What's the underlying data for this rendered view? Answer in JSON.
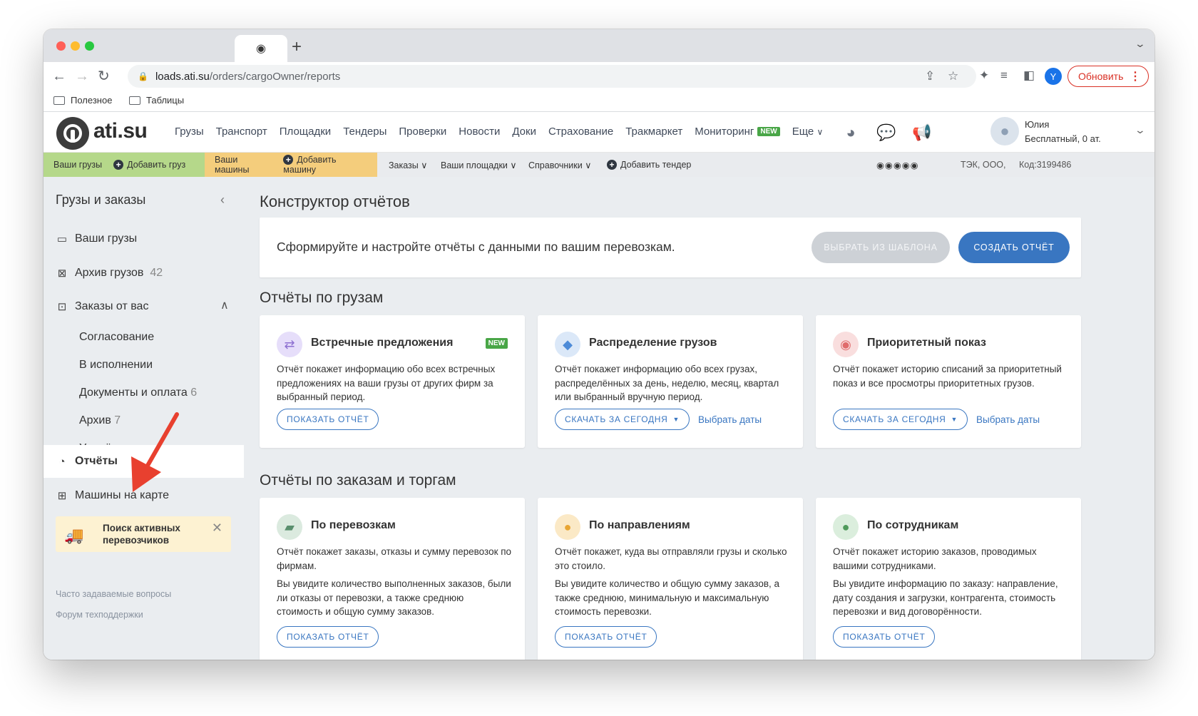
{
  "browser": {
    "url_host": "loads.ati.su",
    "url_path": "/orders/cargoOwner/reports",
    "update_label": "Обновить",
    "avatar_letter": "Y",
    "tab_icon": "ati-logo-icon",
    "new_tab": "+",
    "bookmarks": [
      "Полезное",
      "Таблицы"
    ]
  },
  "header": {
    "logo_text": "ati.su",
    "nav": [
      "Грузы",
      "Транспорт",
      "Площадки",
      "Тендеры",
      "Проверки",
      "Новости",
      "Доки",
      "Страхование",
      "Тракмаркет",
      "Мониторинг"
    ],
    "new_badge": "NEW",
    "more": "Еще",
    "user_name": "Юлия",
    "user_plan": "Бесплатный,  0 ат."
  },
  "subnav": {
    "your_cargo": "Ваши грузы",
    "add_cargo": "Добавить груз",
    "your_machines": "Ваши машины",
    "add_machine": "Добавить машину",
    "orders": "Заказы",
    "platforms": "Ваши площадки",
    "references": "Справочники",
    "add_tender": "Добавить тендер",
    "rating": "◉◉◉◉◉",
    "company": "ТЭК, ООО,",
    "code": "Код:3199486"
  },
  "sidebar": {
    "title": "Грузы и заказы",
    "items": [
      {
        "label": "Ваши грузы",
        "count": ""
      },
      {
        "label": "Архив грузов",
        "count": "42"
      },
      {
        "label": "Заказы от вас",
        "count": ""
      }
    ],
    "subitems": [
      {
        "label": "Согласование",
        "count": ""
      },
      {
        "label": "В исполнении",
        "count": ""
      },
      {
        "label": "Документы и оплата",
        "count": "6"
      },
      {
        "label": "Архив",
        "count": "7"
      },
      {
        "label": "Удалённые",
        "count": ""
      }
    ],
    "reports": "Отчёты",
    "map": "Машины на карте",
    "promo": "Поиск активных перевозчиков",
    "faq": "Часто задаваемые вопросы",
    "forum": "Форум техподдержки"
  },
  "main": {
    "title": "Конструктор отчётов",
    "banner_text": "Сформируйте и настройте отчёты с данными по вашим перевозкам.",
    "template_btn": "ВЫБРАТЬ ИЗ ШАБЛОНА",
    "create_btn": "СОЗДАТЬ ОТЧЁТ",
    "section1": "Отчёты по грузам",
    "section2": "Отчёты по заказам и торгам",
    "show_btn": "ПОКАЗАТЬ ОТЧЁТ",
    "download_btn": "СКАЧАТЬ ЗА СЕГОДНЯ",
    "pick_dates": "Выбрать даты",
    "cards1": [
      {
        "title": "Встречные предложения",
        "badge": "NEW",
        "desc": "Отчёт покажет информацию обо всех встречных предложениях на ваши грузы от других фирм за выбранный период.",
        "icon": "arrows-exchange-icon",
        "color": "#8d6fd1"
      },
      {
        "title": "Распределение грузов",
        "badge": "",
        "desc": "Отчёт покажет информацию обо всех грузах, распределённых за день, неделю, месяц, квартал или выбранный вручную период.",
        "icon": "box-icon",
        "color": "#4d8bd8"
      },
      {
        "title": "Приоритетный показ",
        "badge": "",
        "desc": "Отчёт покажет историю списаний за приоритетный показ и все просмотры приоритетных грузов.",
        "icon": "eye-icon",
        "color": "#e06b6b"
      }
    ],
    "cards2": [
      {
        "title": "По перевозкам",
        "desc1": "Отчёт покажет заказы, отказы и сумму перевозок по фирмам.",
        "desc2": "Вы увидите количество выполненных заказов, были ли отказы от перевозки, а также среднюю стоимость и общую сумму заказов.",
        "icon": "truck-icon",
        "color": "#5a8f6e"
      },
      {
        "title": "По направлениям",
        "desc1": "Отчёт покажет, куда вы отправляли грузы и сколько это стоило.",
        "desc2": "Вы увидите количество и общую сумму заказов, а также среднюю, минимальную и максимальную стоимость перевозки.",
        "icon": "map-pin-icon",
        "color": "#e8a533"
      },
      {
        "title": "По сотрудникам",
        "desc1": "Отчёт покажет историю заказов, проводимых вашими сотрудниками.",
        "desc2": "Вы увидите информацию по заказу: направление, дату создания и загрузки, контрагента, стоимость перевозки и вид договорённости.",
        "icon": "person-icon",
        "color": "#4f9a5b"
      }
    ]
  }
}
